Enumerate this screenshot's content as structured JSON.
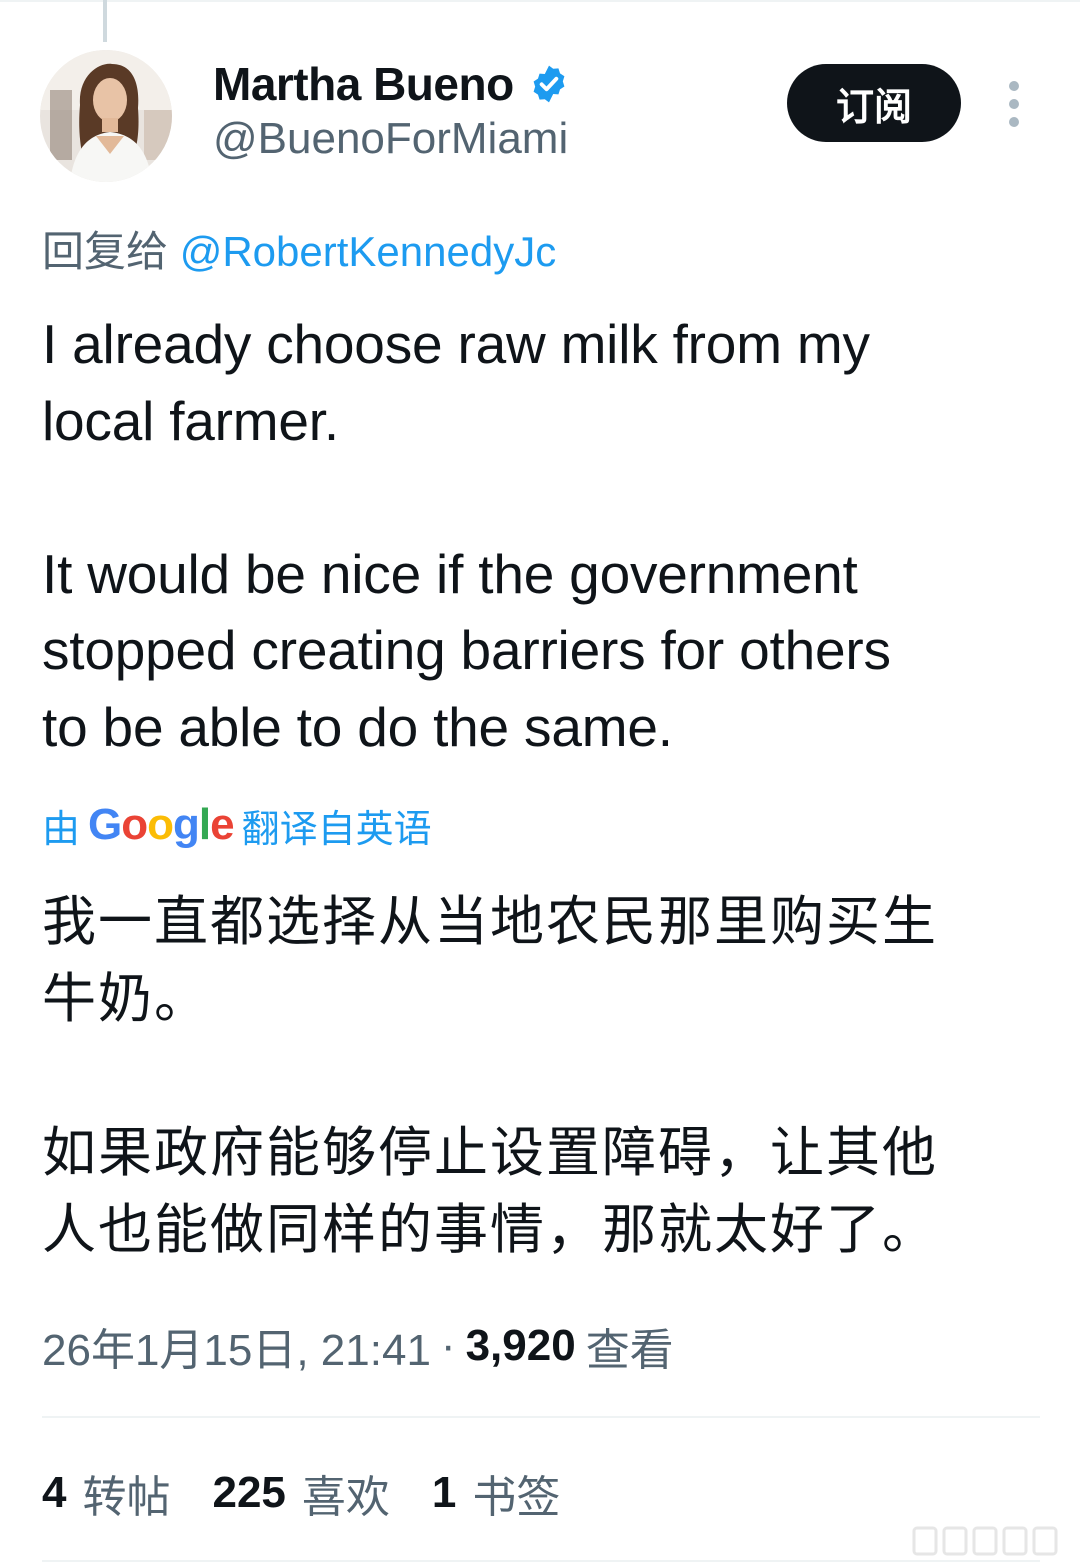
{
  "author": {
    "display_name": "Martha Bueno",
    "handle": "@BuenoForMiami",
    "verified": true
  },
  "subscribe_label": "订阅",
  "reply_to": {
    "prefix": "回复给",
    "mention": "@RobertKennedyJc"
  },
  "tweet": {
    "text": "I already choose raw milk from my\nlocal farmer.\n\nIt would be nice if the government\nstopped creating barriers for others\nto be able to do the same."
  },
  "translation": {
    "prefix": "由",
    "provider": "Google",
    "suffix": "翻译自英语",
    "text": "我一直都选择从当地农民那里购买生\n牛奶。\n\n如果政府能够停止设置障碍，让其他\n人也能做同样的事情，那就太好了。"
  },
  "meta": {
    "timestamp": "26年1月15日, 21:41",
    "separator": "·",
    "views_count": "3,920",
    "views_label": "查看"
  },
  "stats": {
    "reposts_count": "4",
    "reposts_label": "转帖",
    "likes_count": "225",
    "likes_label": "喜欢",
    "bookmarks_count": "1",
    "bookmarks_label": "书签"
  },
  "colors": {
    "text_primary": "#0f1419",
    "text_secondary": "#536471",
    "accent_blue": "#1d9bf0",
    "button_bg": "#0f1419",
    "divider": "#eff3f4"
  },
  "icons": {
    "verified": "verified-badge-icon",
    "more": "more-vertical-icon"
  }
}
